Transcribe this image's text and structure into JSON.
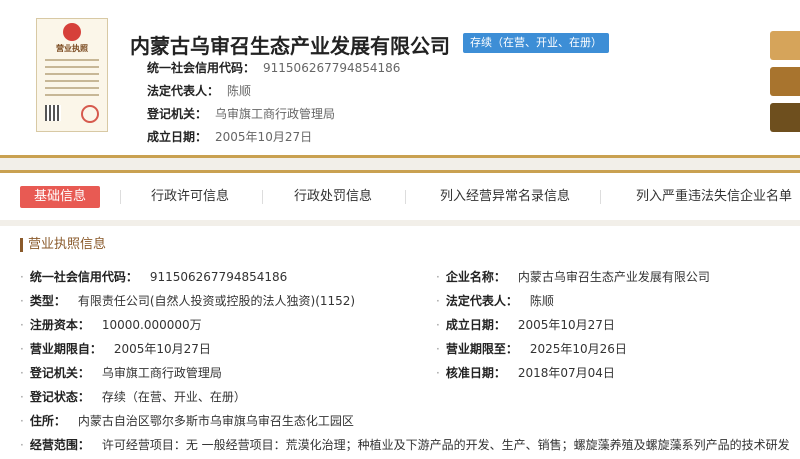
{
  "header": {
    "license_label": "营业执照",
    "company_name": "内蒙古乌审召生态产业发展有限公司",
    "status": "存续（在营、开业、在册）",
    "fields": [
      {
        "label": "统一社会信用代码：",
        "value": "911506267794854186"
      },
      {
        "label": "法定代表人：",
        "value": "陈顺"
      },
      {
        "label": "登记机关：",
        "value": "乌审旗工商行政管理局"
      },
      {
        "label": "成立日期：",
        "value": "2005年10月27日"
      }
    ],
    "side_button_colors": [
      "#d6a45a",
      "#a8742e",
      "#6e4f1e"
    ]
  },
  "tabs": [
    {
      "label": "基础信息",
      "active": true
    },
    {
      "label": "行政许可信息"
    },
    {
      "label": "行政处罚信息"
    },
    {
      "label": "列入经营异常名录信息"
    },
    {
      "label": "列入严重违法失信企业名单（"
    }
  ],
  "section": {
    "title": "营业执照信息",
    "left_rows": [
      {
        "label": "统一社会信用代码：",
        "value": "911506267794854186"
      },
      {
        "label": "类型：",
        "value": "有限责任公司(自然人投资或控股的法人独资)(1152)"
      },
      {
        "label": "注册资本：",
        "value": "10000.000000万"
      },
      {
        "label": "营业期限自：",
        "value": "2005年10月27日"
      },
      {
        "label": "登记机关：",
        "value": "乌审旗工商行政管理局"
      },
      {
        "label": "登记状态：",
        "value": "存续（在营、开业、在册）"
      },
      {
        "label": "住所：",
        "value": "内蒙古自治区鄂尔多斯市乌审旗乌审召生态化工园区"
      },
      {
        "label": "经营范围：",
        "value": "许可经营项目：无 一般经营项目：荒漠化治理；种植业及下游产品的开发、生产、销售；螺旋藻养殖及螺旋藻系列产品的技术研发"
      }
    ],
    "right_rows": [
      {
        "label": "企业名称：",
        "value": "内蒙古乌审召生态产业发展有限公司"
      },
      {
        "label": "法定代表人：",
        "value": "陈顺"
      },
      {
        "label": "成立日期：",
        "value": "2005年10月27日"
      },
      {
        "label": "营业期限至：",
        "value": "2025年10月26日"
      },
      {
        "label": "核准日期：",
        "value": "2018年07月04日"
      }
    ]
  }
}
